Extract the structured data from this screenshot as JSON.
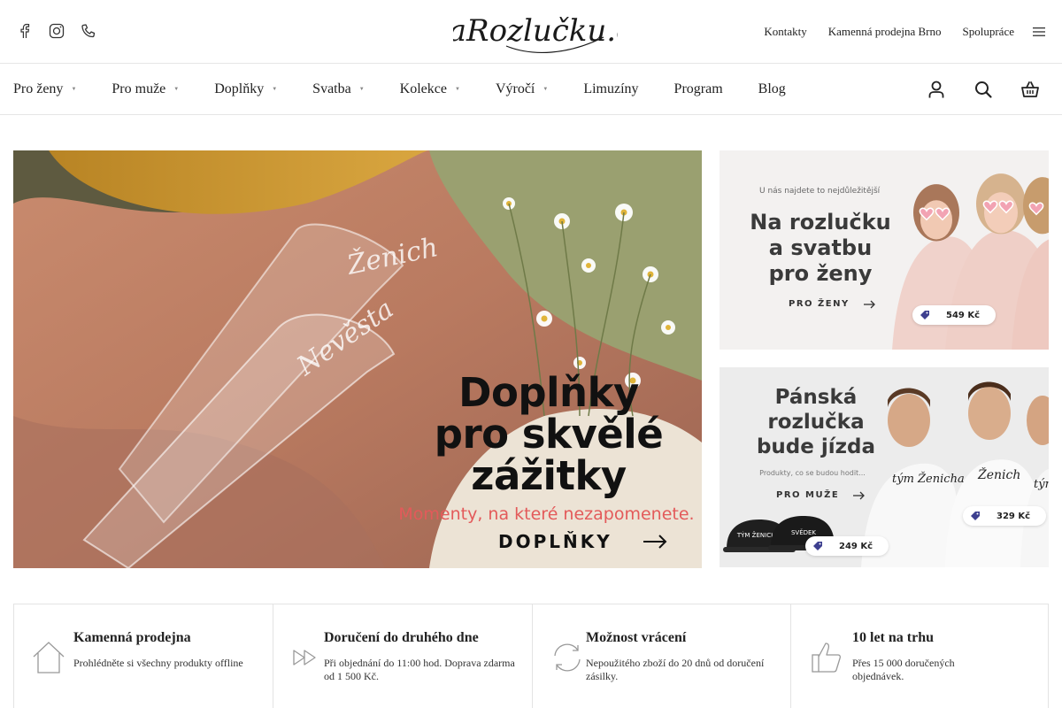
{
  "header": {
    "social": [
      "facebook-icon",
      "instagram-icon",
      "phone-icon"
    ],
    "logo_text": "NaRozlučku.cz",
    "links": [
      "Kontakty",
      "Kamenná prodejna Brno",
      "Spolupráce"
    ]
  },
  "nav": {
    "items": [
      {
        "label": "Pro ženy",
        "has_dropdown": true
      },
      {
        "label": "Pro muže",
        "has_dropdown": true
      },
      {
        "label": "Doplňky",
        "has_dropdown": true
      },
      {
        "label": "Svatba",
        "has_dropdown": true
      },
      {
        "label": "Kolekce",
        "has_dropdown": true
      },
      {
        "label": "Výročí",
        "has_dropdown": true
      },
      {
        "label": "Limuzíny",
        "has_dropdown": false
      },
      {
        "label": "Program",
        "has_dropdown": false
      },
      {
        "label": "Blog",
        "has_dropdown": false
      }
    ],
    "caret": "▼",
    "icons": [
      "user-icon",
      "search-icon",
      "basket-icon"
    ]
  },
  "hero": {
    "title_lines": [
      "Doplňky",
      "pro skvělé",
      "zážitky"
    ],
    "subtitle": "Momenty, na které nezapomenete.",
    "cta": "DOPLŇKY",
    "glass_1": "Ženich",
    "glass_2": "Nevěsta"
  },
  "banner_women": {
    "tagline": "U nás najdete to nejdůležitější",
    "title_lines": [
      "Na rozlučku",
      "a svatbu",
      "pro ženy"
    ],
    "cta": "PRO ŽENY",
    "price": "549 Kč"
  },
  "banner_men": {
    "title_lines": [
      "Pánská",
      "rozlučka",
      "bude jízda"
    ],
    "tagline": "Produkty, co se budou hodit...",
    "cta": "PRO MUŽE",
    "shirt_1": "tým Ženicha",
    "shirt_2": "Ženich",
    "shirt_3": "tým Ženicha",
    "cap_1": "TÝM ŽENICHA",
    "cap_2": "SVĚDEK",
    "price_shirt": "329 Kč",
    "price_caps": "249 Kč"
  },
  "features": [
    {
      "icon": "house-icon",
      "title": "Kamenná prodejna",
      "desc": "Prohlédněte si všechny produkty offline"
    },
    {
      "icon": "fast-forward-icon",
      "title": "Doručení do druhého dne",
      "desc": "Při objednání do 11:00 hod. Doprava zdarma od 1 500 Kč."
    },
    {
      "icon": "refresh-icon",
      "title": "Možnost vrácení",
      "desc": "Nepoužitého zboží do 20 dnů od doručení zásilky."
    },
    {
      "icon": "thumbs-up-icon",
      "title": "10 let na trhu",
      "desc": "Přes 15 000 doručených objednávek."
    }
  ]
}
